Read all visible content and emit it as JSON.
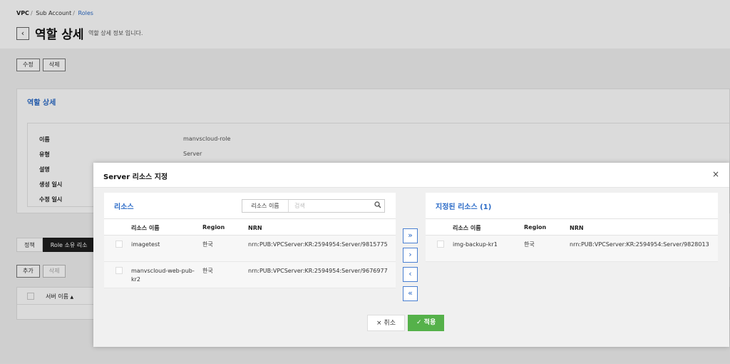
{
  "breadcrumb": {
    "items": [
      "VPC",
      "Sub Account",
      "Roles"
    ]
  },
  "page": {
    "title": "역할 상세",
    "subtitle": "역할 상세 정보 입니다.",
    "back_icon": "chevron-left-icon"
  },
  "actions": {
    "edit_label": "수정",
    "delete_label": "삭제"
  },
  "details": {
    "title": "역할 상세",
    "rows": [
      {
        "label": "이름",
        "value": "manvscloud-role"
      },
      {
        "label": "유형",
        "value": "Server"
      },
      {
        "label": "설명",
        "value": ""
      },
      {
        "label": "생성 일시",
        "value": ""
      },
      {
        "label": "수정 일시",
        "value": ""
      }
    ]
  },
  "tabs": [
    {
      "label": "정책"
    },
    {
      "label": "Role 소유 리소"
    }
  ],
  "resource_actions": {
    "add_label": "추가",
    "remove_label": "삭제"
  },
  "resource_table": {
    "server_name_col": "서버 이름",
    "sort_icon": "▲"
  },
  "modal": {
    "title": "Server 리소스 지정",
    "close_icon": "×",
    "left": {
      "title": "리소스",
      "search_select": "리소스 이름",
      "search_placeholder": "검색",
      "columns": {
        "name": "리소스 이름",
        "region": "Region",
        "nrn": "NRN"
      },
      "rows": [
        {
          "name": "imagetest",
          "region": "한국",
          "nrn": "nrn:PUB:VPCServer:KR:2594954:Server/9815775"
        },
        {
          "name": "manvscloud-web-pub-kr2",
          "region": "한국",
          "nrn": "nrn:PUB:VPCServer:KR:2594954:Server/9676977"
        }
      ]
    },
    "right": {
      "title": "지정된 리소스 (1)",
      "columns": {
        "name": "리소스 이름",
        "region": "Region",
        "nrn": "NRN"
      },
      "rows": [
        {
          "name": "img-backup-kr1",
          "region": "한국",
          "nrn": "nrn:PUB:VPCServer:KR:2594954:Server/9828013"
        }
      ]
    },
    "transfer": {
      "add_all": "»",
      "add": "›",
      "remove": "‹",
      "remove_all": "«"
    },
    "cancel_label": "취소",
    "apply_label": "적용",
    "cancel_icon": "×",
    "apply_icon": "✓"
  },
  "colors": {
    "accent": "#2a6ac7",
    "apply": "#55b14a",
    "active_tab": "#1f1f1f"
  }
}
